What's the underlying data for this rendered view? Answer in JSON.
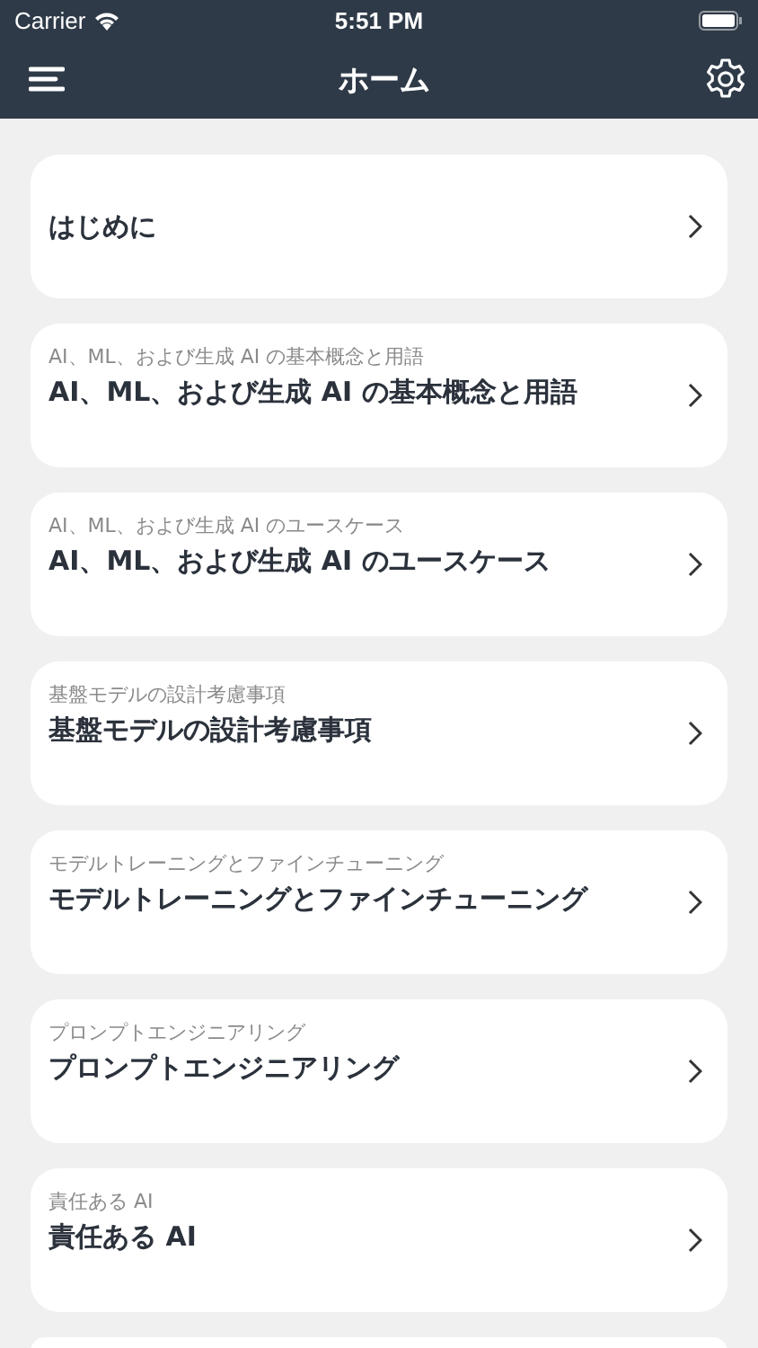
{
  "status_bar": {
    "carrier": "Carrier",
    "time": "5:51 PM"
  },
  "nav": {
    "title": "ホーム"
  },
  "items": [
    {
      "title": "はじめに"
    },
    {
      "subtitle": "AI、ML、および生成 AI の基本概念と用語",
      "title": "AI、ML、および生成 AI の基本概念と用語"
    },
    {
      "subtitle": "AI、ML、および生成 AI のユースケース",
      "title": "AI、ML、および生成 AI のユースケース"
    },
    {
      "subtitle": "基盤モデルの設計考慮事項",
      "title": "基盤モデルの設計考慮事項"
    },
    {
      "subtitle": "モデルトレーニングとファインチューニング",
      "title": "モデルトレーニングとファインチューニング"
    },
    {
      "subtitle": "プロンプトエンジニアリング",
      "title": "プロンプトエンジニアリング"
    },
    {
      "subtitle": "責任ある AI",
      "title": "責任ある AI"
    }
  ]
}
